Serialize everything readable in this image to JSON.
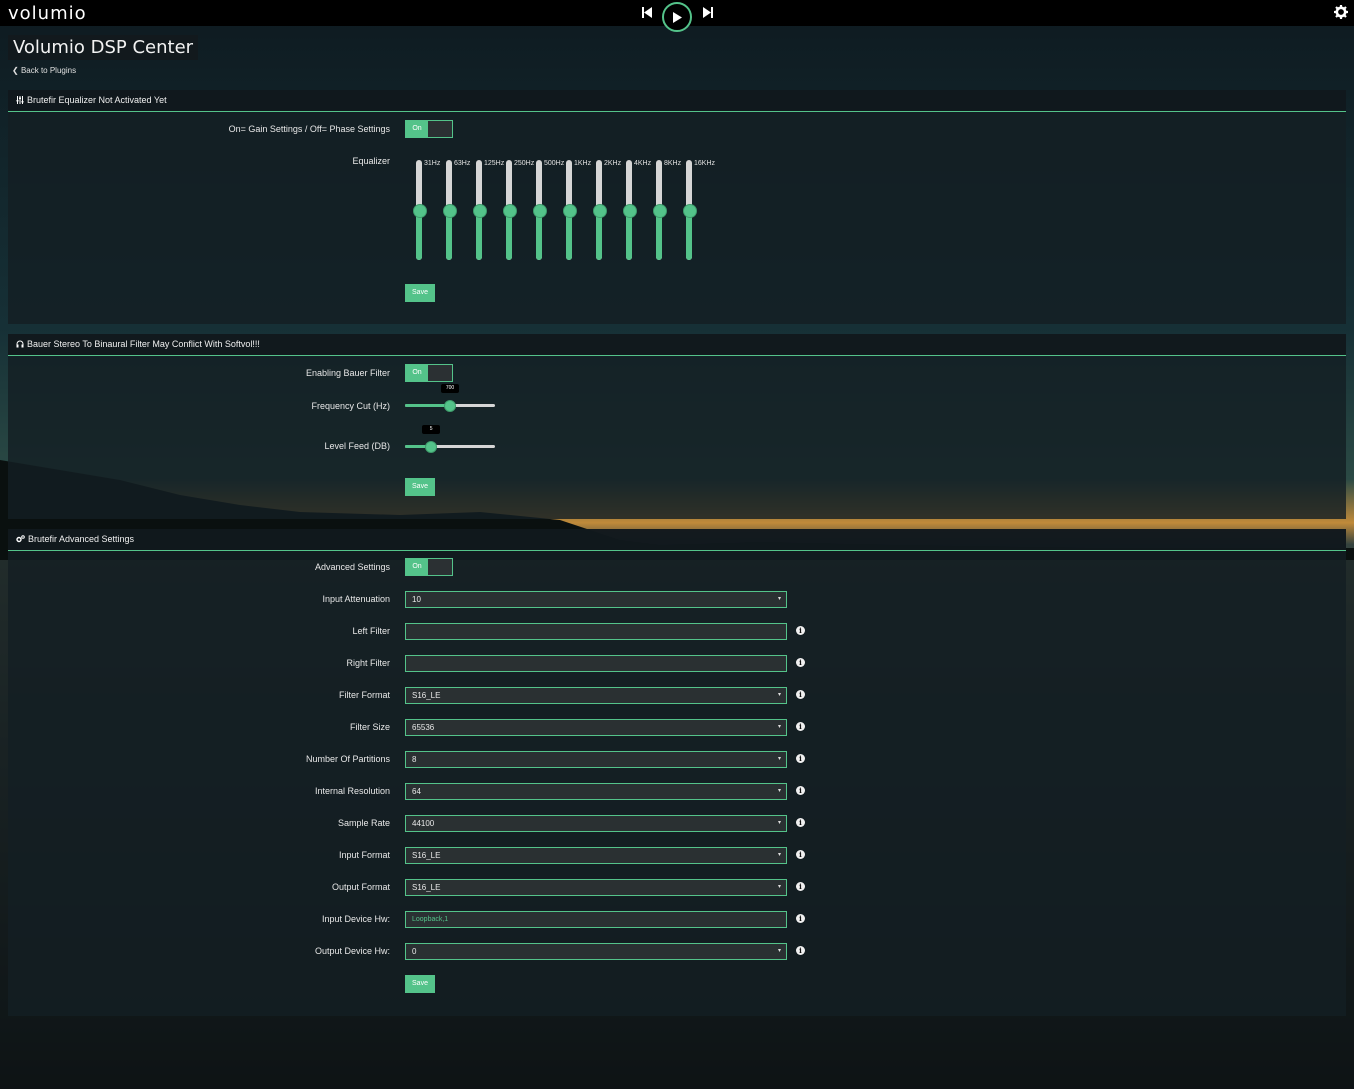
{
  "header": {
    "logo": "volumio"
  },
  "page": {
    "title": "Volumio DSP Center",
    "back_label": "Back to Plugins"
  },
  "colors": {
    "accent": "#54c38a",
    "topbar": "#000000"
  },
  "equalizer_section": {
    "title": "Brutefir Equalizer Not Activated Yet",
    "toggle_label": "On= Gain Settings / Off= Phase Settings",
    "toggle_state": "On",
    "equalizer_label": "Equalizer",
    "bands": [
      {
        "label": "31Hz",
        "level": 0.5
      },
      {
        "label": "63Hz",
        "level": 0.5
      },
      {
        "label": "125Hz",
        "level": 0.5
      },
      {
        "label": "250Hz",
        "level": 0.5
      },
      {
        "label": "500Hz",
        "level": 0.5
      },
      {
        "label": "1KHz",
        "level": 0.5
      },
      {
        "label": "2KHz",
        "level": 0.5
      },
      {
        "label": "4KHz",
        "level": 0.5
      },
      {
        "label": "8KHz",
        "level": 0.5
      },
      {
        "label": "16KHz",
        "level": 0.5
      }
    ],
    "save_label": "Save"
  },
  "bauer_section": {
    "title": "Bauer Stereo To Binaural Filter May Conflict With Softvol!!!",
    "enable_label": "Enabling Bauer Filter",
    "enable_state": "On",
    "freq_label": "Frequency Cut (Hz)",
    "freq_value": "700",
    "freq_fraction": 0.5,
    "level_label": "Level Feed (DB)",
    "level_value": "5",
    "level_fraction": 0.29,
    "save_label": "Save"
  },
  "advanced_section": {
    "title": "Brutefir Advanced Settings",
    "advanced_label": "Advanced Settings",
    "advanced_state": "On",
    "fields": [
      {
        "label": "Input Attenuation",
        "value": "10",
        "select": true,
        "info": false
      },
      {
        "label": "Left Filter",
        "value": "",
        "select": false,
        "info": true
      },
      {
        "label": "Right Filter",
        "value": "",
        "select": false,
        "info": true
      },
      {
        "label": "Filter Format",
        "value": "S16_LE",
        "select": true,
        "info": true
      },
      {
        "label": "Filter Size",
        "value": "65536",
        "select": true,
        "info": true
      },
      {
        "label": "Number Of Partitions",
        "value": "8",
        "select": true,
        "info": true
      },
      {
        "label": "Internal Resolution",
        "value": "64",
        "select": true,
        "info": true
      },
      {
        "label": "Sample Rate",
        "value": "44100",
        "select": true,
        "info": true
      },
      {
        "label": "Input Format",
        "value": "S16_LE",
        "select": true,
        "info": true
      },
      {
        "label": "Output Format",
        "value": "S16_LE",
        "select": true,
        "info": true
      },
      {
        "label": "Input Device Hw:",
        "value": "",
        "placeholder": "Loopback,1",
        "select": false,
        "info": true
      },
      {
        "label": "Output Device Hw:",
        "value": "0",
        "select": true,
        "info": true
      }
    ],
    "save_label": "Save"
  }
}
